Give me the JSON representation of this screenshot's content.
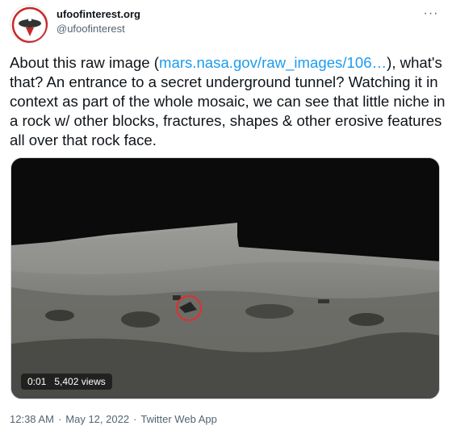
{
  "author": {
    "display_name": "ufoofinterest.org",
    "handle": "@ufoofinterest",
    "avatar_icon": "ufo-logo-icon"
  },
  "menu": {
    "more_label": "···"
  },
  "tweet": {
    "text_prefix": "About this raw image (",
    "link_text": "mars.nasa.gov/raw_images/106…",
    "text_suffix": "), what's that? An entrance to a secret underground tunnel? Watching it in context as part of the whole mosaic, we can see that little niche in a rock w/ other blocks, fractures, shapes & other erosive features all over that rock face."
  },
  "media": {
    "type": "video",
    "time": "0:01",
    "views": "5,402 views",
    "highlight_color": "#e0302b"
  },
  "meta": {
    "time": "12:38 AM",
    "separator": "·",
    "date": "May 12, 2022",
    "source": "Twitter Web App"
  },
  "colors": {
    "link": "#1d9bf0",
    "secondary_text": "#536471"
  }
}
